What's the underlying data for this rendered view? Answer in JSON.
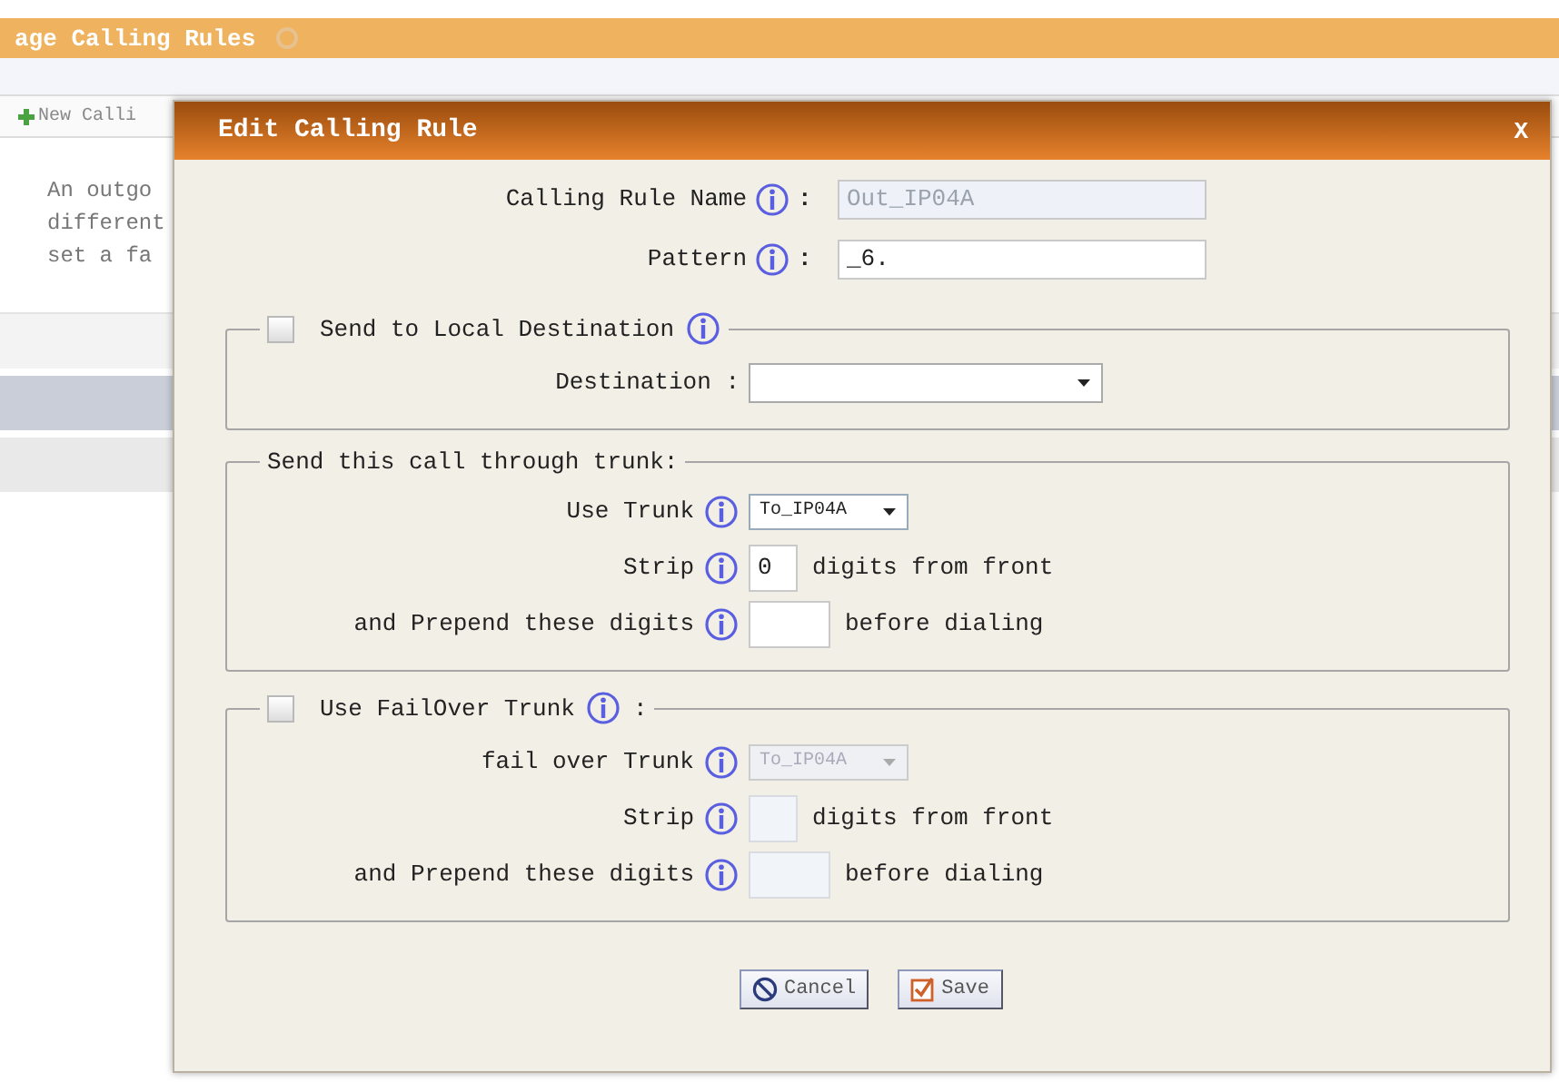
{
  "page": {
    "title": "age Calling Rules",
    "toolbar": {
      "new_button": "New Calli"
    },
    "description": [
      "An outgo",
      "different",
      "set a fa"
    ]
  },
  "dialog": {
    "title": "Edit Calling Rule",
    "close": "X",
    "fields": [
      {
        "label": "Calling Rule Name",
        "separator": ":",
        "value": "Out_IP04A",
        "disabled": true
      },
      {
        "label": "Pattern",
        "separator": ":",
        "value": "_6.",
        "disabled": false
      }
    ],
    "sections": [
      {
        "kind": "checkable",
        "legend": "Send to Local Destination",
        "checked": false,
        "info": true,
        "rows": [
          {
            "kind": "select",
            "label": "Destination :",
            "info": false,
            "disabled": false
          }
        ]
      },
      {
        "kind": "plain",
        "legend": "Send this call through trunk:",
        "info": false,
        "rows": [
          {
            "kind": "select",
            "label": "Use Trunk",
            "info": true,
            "value": "To_IP04A",
            "disabled": false
          },
          {
            "kind": "count",
            "label": "Strip",
            "info": true,
            "value": "0",
            "suffix": "digits from front",
            "disabled": false
          },
          {
            "kind": "digits",
            "label": "and Prepend these digits",
            "info": true,
            "suffix": "before dialing",
            "disabled": false
          }
        ]
      },
      {
        "kind": "checkable",
        "legend": "Use FailOver Trunk",
        "legend_suffix": ":",
        "checked": false,
        "info": true,
        "rows": [
          {
            "kind": "select",
            "label": "fail over Trunk",
            "info": true,
            "value": "To_IP04A",
            "disabled": true
          },
          {
            "kind": "count",
            "label": "Strip",
            "info": true,
            "suffix": "digits from front",
            "disabled": true
          },
          {
            "kind": "digits",
            "label": "and Prepend these digits",
            "info": true,
            "suffix": "before dialing",
            "disabled": true
          }
        ]
      }
    ],
    "buttons": [
      {
        "kind": "cancel",
        "label": "Cancel"
      },
      {
        "kind": "save",
        "label": "Save"
      }
    ]
  }
}
